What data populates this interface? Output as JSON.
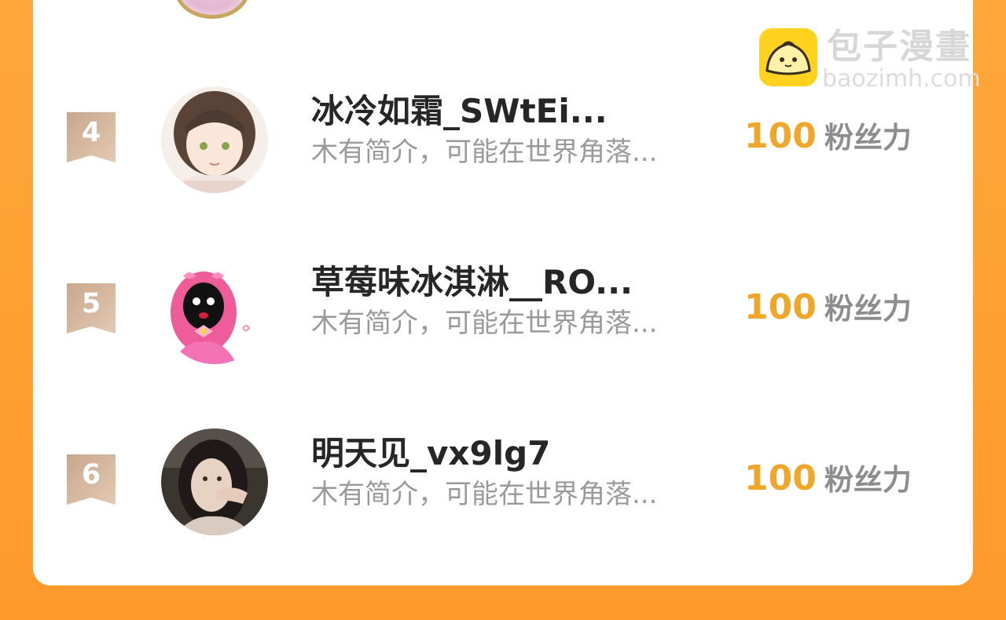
{
  "watermark": {
    "logo_icon": "bun-mascot-icon",
    "title": "包子漫畫",
    "url": "baozimh.com"
  },
  "ranking": [
    {
      "rank": "4",
      "name": "冰冷如霜_SWtEi...",
      "bio": "木有简介，可能在世界角落...",
      "fans_count": "100",
      "fans_label": "粉丝力"
    },
    {
      "rank": "5",
      "name": "草莓味冰淇淋__RO...",
      "bio": "木有简介，可能在世界角落...",
      "fans_count": "100",
      "fans_label": "粉丝力"
    },
    {
      "rank": "6",
      "name": "明天见_vx9lg7",
      "bio": "木有简介，可能在世界角落...",
      "fans_count": "100",
      "fans_label": "粉丝力"
    }
  ],
  "colors": {
    "background": "#ff9f2f",
    "card": "#ffffff",
    "fans_number": "#efa72a",
    "badge": "#d2b299"
  }
}
